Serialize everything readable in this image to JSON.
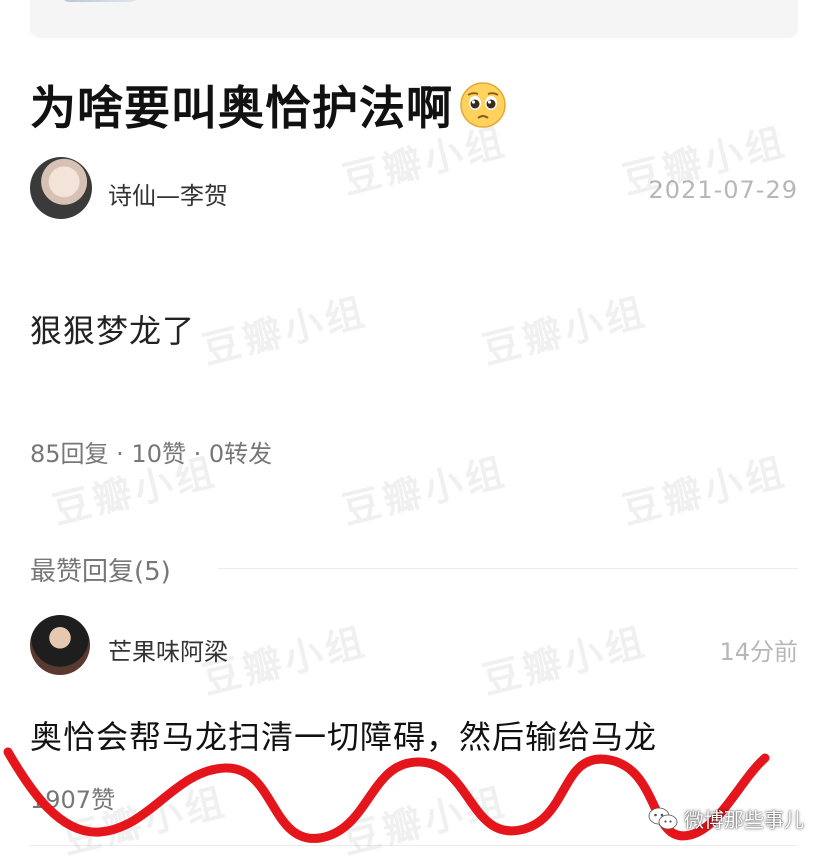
{
  "post": {
    "title": "为啥要叫奥恰护法啊",
    "title_emoji": "pleading-face-emoji",
    "author": "诗仙—李贺",
    "date": "2021-07-29",
    "body": "狠狠梦龙了",
    "stats": "85回复 · 10赞 · 0转发"
  },
  "section": {
    "header": "最赞回复(5)"
  },
  "reply": {
    "author": "芒果味阿梁",
    "time": "14分前",
    "text": "奥恰会帮马龙扫清一切障碍，然后输给马龙",
    "likes": "1907赞"
  },
  "watermark": {
    "text": "豆瓣小组"
  },
  "source": {
    "label": "微博那些事儿",
    "icon": "wechat-icon"
  },
  "colors": {
    "scribble": "#e4151b",
    "muted_text": "#777777",
    "date_text": "#b7b7b7"
  }
}
